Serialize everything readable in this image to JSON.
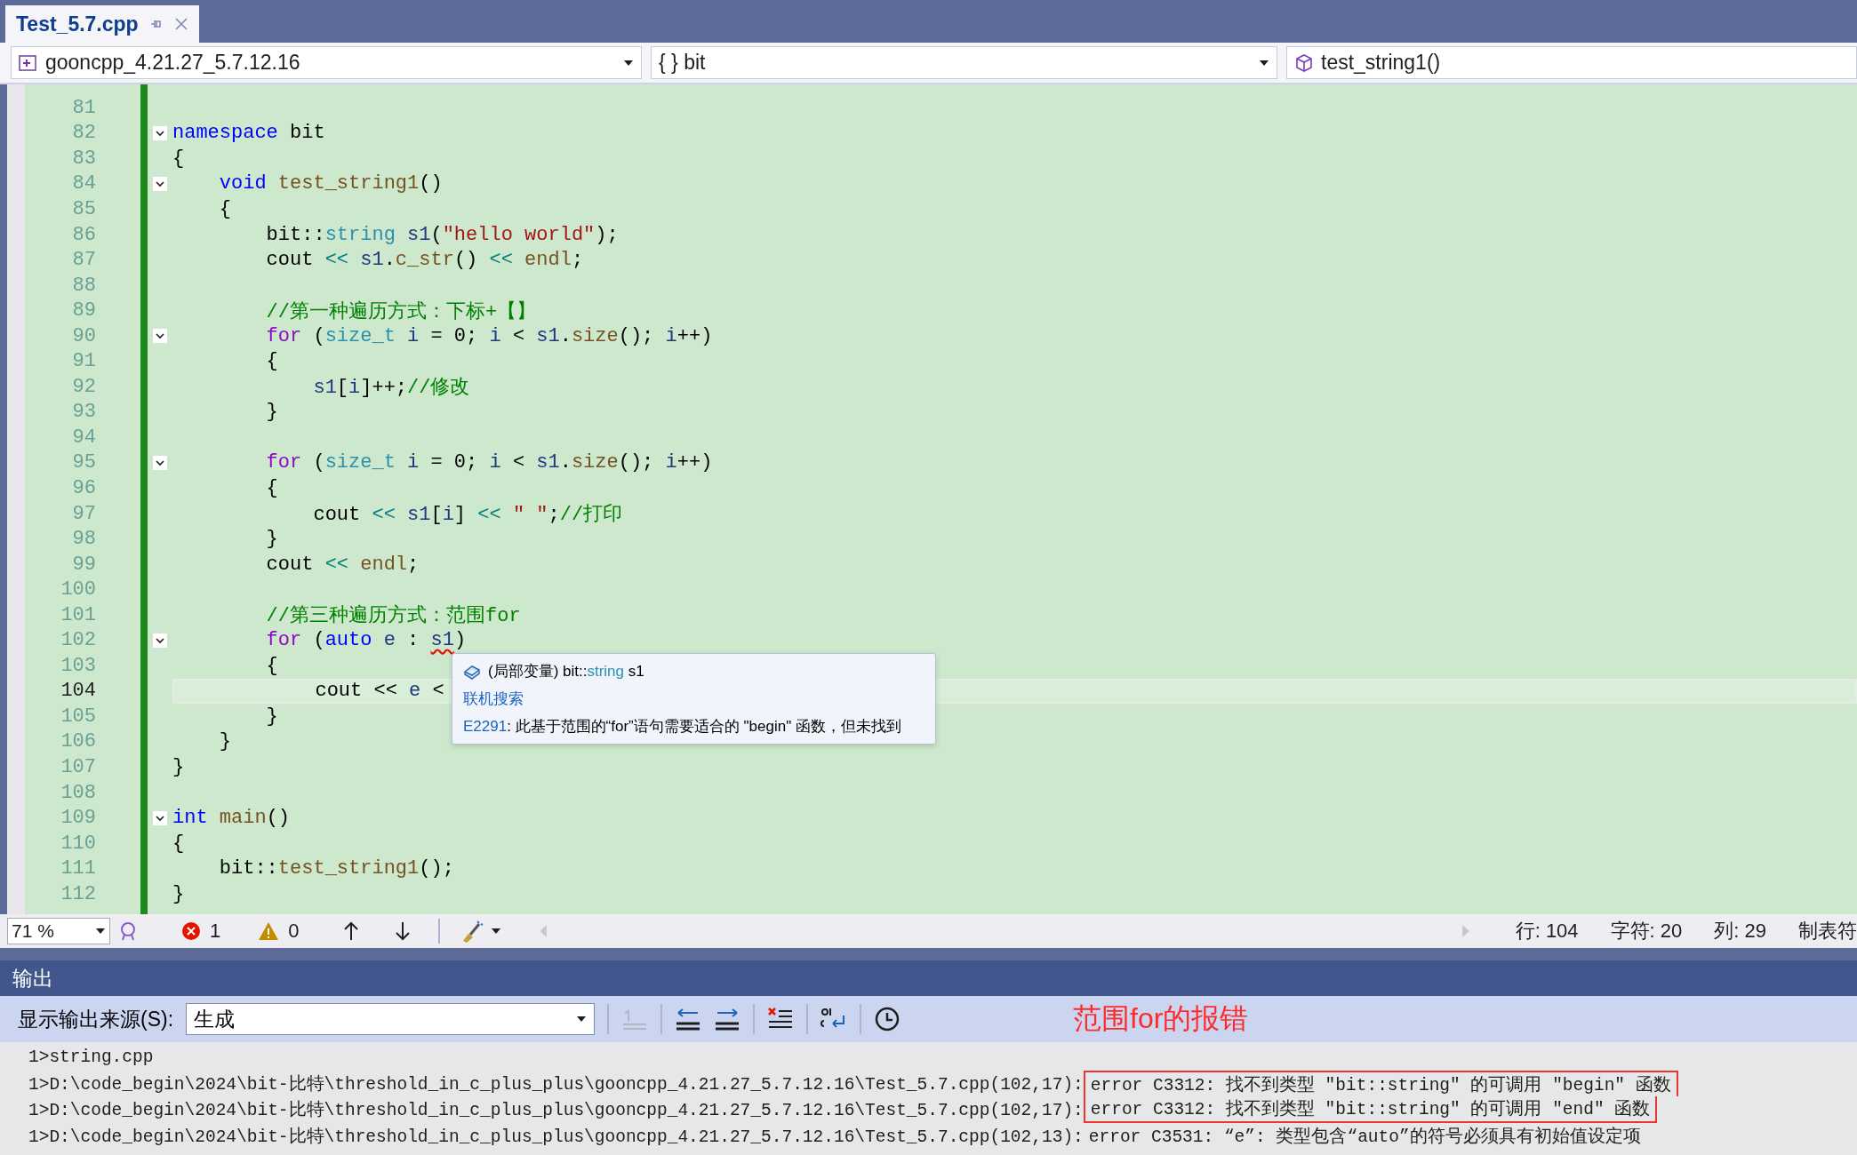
{
  "tabs": [
    {
      "label": "Test_5.7.cpp",
      "selected": true
    }
  ],
  "navigation": {
    "project": "gooncpp_4.21.27_5.7.12.16",
    "scope": "{ } bit",
    "member": "test_string1()"
  },
  "editor": {
    "lines": [
      {
        "number": "81",
        "fold": false,
        "current": false
      },
      {
        "number": "82",
        "fold": true,
        "current": false,
        "tokens": [
          {
            "text": "namespace ",
            "kind": "kw"
          },
          {
            "text": "bit",
            "kind": "plain"
          }
        ]
      },
      {
        "number": "83",
        "fold": false,
        "current": false,
        "tokens": [
          {
            "text": "{",
            "kind": "plain"
          }
        ]
      },
      {
        "number": "84",
        "fold": true,
        "current": false,
        "tokens": [
          {
            "text": "    void ",
            "kind": "kw"
          },
          {
            "text": "test_string1",
            "kind": "fn"
          },
          {
            "text": "()",
            "kind": "plain"
          }
        ]
      },
      {
        "number": "85",
        "fold": false,
        "current": false,
        "tokens": [
          {
            "text": "    {",
            "kind": "plain"
          }
        ]
      },
      {
        "number": "86",
        "fold": false,
        "current": false,
        "tokens": [
          {
            "text": "        bit::",
            "kind": "plain"
          },
          {
            "text": "string ",
            "kind": "type"
          },
          {
            "text": "s1",
            "kind": "var"
          },
          {
            "text": "(",
            "kind": "plain"
          },
          {
            "text": "\"hello world\"",
            "kind": "str"
          },
          {
            "text": ");",
            "kind": "plain"
          }
        ]
      },
      {
        "number": "87",
        "fold": false,
        "current": false,
        "tokens": [
          {
            "text": "        cout ",
            "kind": "plain"
          },
          {
            "text": "<< ",
            "kind": "op"
          },
          {
            "text": "s1",
            "kind": "var"
          },
          {
            "text": ".",
            "kind": "plain"
          },
          {
            "text": "c_str",
            "kind": "fn"
          },
          {
            "text": "() ",
            "kind": "plain"
          },
          {
            "text": "<< ",
            "kind": "op"
          },
          {
            "text": "endl",
            "kind": "fn"
          },
          {
            "text": ";",
            "kind": "plain"
          }
        ]
      },
      {
        "number": "88",
        "fold": false,
        "current": false
      },
      {
        "number": "89",
        "fold": false,
        "current": false,
        "tokens": [
          {
            "text": "        //第一种遍历方式：下标+【】",
            "kind": "cmt"
          }
        ]
      },
      {
        "number": "90",
        "fold": true,
        "current": false,
        "tokens": [
          {
            "text": "        for",
            "kind": "ctl"
          },
          {
            "text": " (",
            "kind": "plain"
          },
          {
            "text": "size_t ",
            "kind": "type"
          },
          {
            "text": "i",
            "kind": "var"
          },
          {
            "text": " = 0; ",
            "kind": "plain"
          },
          {
            "text": "i",
            "kind": "var"
          },
          {
            "text": " < ",
            "kind": "plain"
          },
          {
            "text": "s1",
            "kind": "var"
          },
          {
            "text": ".",
            "kind": "plain"
          },
          {
            "text": "size",
            "kind": "fn"
          },
          {
            "text": "(); ",
            "kind": "plain"
          },
          {
            "text": "i",
            "kind": "var"
          },
          {
            "text": "++)",
            "kind": "plain"
          }
        ]
      },
      {
        "number": "91",
        "fold": false,
        "current": false,
        "tokens": [
          {
            "text": "        {",
            "kind": "plain"
          }
        ]
      },
      {
        "number": "92",
        "fold": false,
        "current": false,
        "tokens": [
          {
            "text": "            s1",
            "kind": "var"
          },
          {
            "text": "[",
            "kind": "plain"
          },
          {
            "text": "i",
            "kind": "var"
          },
          {
            "text": "]++;",
            "kind": "plain"
          },
          {
            "text": "//修改",
            "kind": "cmt"
          }
        ]
      },
      {
        "number": "93",
        "fold": false,
        "current": false,
        "tokens": [
          {
            "text": "        }",
            "kind": "plain"
          }
        ]
      },
      {
        "number": "94",
        "fold": false,
        "current": false
      },
      {
        "number": "95",
        "fold": true,
        "current": false,
        "tokens": [
          {
            "text": "        for",
            "kind": "ctl"
          },
          {
            "text": " (",
            "kind": "plain"
          },
          {
            "text": "size_t ",
            "kind": "type"
          },
          {
            "text": "i",
            "kind": "var"
          },
          {
            "text": " = 0; ",
            "kind": "plain"
          },
          {
            "text": "i",
            "kind": "var"
          },
          {
            "text": " < ",
            "kind": "plain"
          },
          {
            "text": "s1",
            "kind": "var"
          },
          {
            "text": ".",
            "kind": "plain"
          },
          {
            "text": "size",
            "kind": "fn"
          },
          {
            "text": "(); ",
            "kind": "plain"
          },
          {
            "text": "i",
            "kind": "var"
          },
          {
            "text": "++)",
            "kind": "plain"
          }
        ]
      },
      {
        "number": "96",
        "fold": false,
        "current": false,
        "tokens": [
          {
            "text": "        {",
            "kind": "plain"
          }
        ]
      },
      {
        "number": "97",
        "fold": false,
        "current": false,
        "tokens": [
          {
            "text": "            cout ",
            "kind": "plain"
          },
          {
            "text": "<< ",
            "kind": "op"
          },
          {
            "text": "s1",
            "kind": "var"
          },
          {
            "text": "[",
            "kind": "plain"
          },
          {
            "text": "i",
            "kind": "var"
          },
          {
            "text": "] ",
            "kind": "plain"
          },
          {
            "text": "<< ",
            "kind": "op"
          },
          {
            "text": "\" \"",
            "kind": "str"
          },
          {
            "text": ";",
            "kind": "plain"
          },
          {
            "text": "//打印",
            "kind": "cmt"
          }
        ]
      },
      {
        "number": "98",
        "fold": false,
        "current": false,
        "tokens": [
          {
            "text": "        }",
            "kind": "plain"
          }
        ]
      },
      {
        "number": "99",
        "fold": false,
        "current": false,
        "tokens": [
          {
            "text": "        cout ",
            "kind": "plain"
          },
          {
            "text": "<< ",
            "kind": "op"
          },
          {
            "text": "endl",
            "kind": "fn"
          },
          {
            "text": ";",
            "kind": "plain"
          }
        ]
      },
      {
        "number": "100",
        "fold": false,
        "current": false
      },
      {
        "number": "101",
        "fold": false,
        "current": false,
        "tokens": [
          {
            "text": "        //第三种遍历方式：范围for",
            "kind": "cmt"
          }
        ]
      },
      {
        "number": "102",
        "fold": true,
        "current": false,
        "tokens": [
          {
            "text": "        for",
            "kind": "ctl"
          },
          {
            "text": " (",
            "kind": "plain"
          },
          {
            "text": "auto ",
            "kind": "kw"
          },
          {
            "text": "e",
            "kind": "var"
          },
          {
            "text": " : ",
            "kind": "plain"
          },
          {
            "text": "s1",
            "kind": "err"
          },
          {
            "text": ")",
            "kind": "plain"
          }
        ]
      },
      {
        "number": "103",
        "fold": false,
        "current": false,
        "tokens": [
          {
            "text": "        {",
            "kind": "plain"
          }
        ]
      },
      {
        "number": "104",
        "fold": false,
        "current": true,
        "tokens": [
          {
            "text": "            cout << ",
            "kind": "plain"
          },
          {
            "text": "e",
            "kind": "var"
          },
          {
            "text": " <",
            "kind": "plain"
          }
        ]
      },
      {
        "number": "105",
        "fold": false,
        "current": false,
        "tokens": [
          {
            "text": "        }",
            "kind": "plain"
          }
        ]
      },
      {
        "number": "106",
        "fold": false,
        "current": false,
        "tokens": [
          {
            "text": "    }",
            "kind": "plain"
          }
        ]
      },
      {
        "number": "107",
        "fold": false,
        "current": false,
        "tokens": [
          {
            "text": "}",
            "kind": "plain"
          }
        ]
      },
      {
        "number": "108",
        "fold": false,
        "current": false
      },
      {
        "number": "109",
        "fold": true,
        "current": false,
        "tokens": [
          {
            "text": "int ",
            "kind": "kw"
          },
          {
            "text": "main",
            "kind": "fn"
          },
          {
            "text": "()",
            "kind": "plain"
          }
        ]
      },
      {
        "number": "110",
        "fold": false,
        "current": false,
        "tokens": [
          {
            "text": "{",
            "kind": "plain"
          }
        ]
      },
      {
        "number": "111",
        "fold": false,
        "current": false,
        "tokens": [
          {
            "text": "    bit::",
            "kind": "plain"
          },
          {
            "text": "test_string1",
            "kind": "fn"
          },
          {
            "text": "();",
            "kind": "plain"
          }
        ]
      },
      {
        "number": "112",
        "fold": false,
        "current": false,
        "tokens": [
          {
            "text": "}",
            "kind": "plain"
          }
        ]
      }
    ],
    "tooltip": {
      "signature": [
        {
          "text": "(局部变量) bit::",
          "kind": "plain"
        },
        {
          "text": "string",
          "kind": "type"
        },
        {
          "text": " s1",
          "kind": "plain"
        }
      ],
      "link": "联机搜索",
      "error_code": "E2291",
      "error_text": ": 此基于范围的“for”语句需要适合的 \"begin\" 函数，但未找到"
    }
  },
  "status_bar": {
    "zoom": "71 %",
    "errors": "1",
    "warnings": "0",
    "line": "行: 104",
    "char": "字符: 20",
    "column": "列: 29",
    "tabs": "制表符"
  },
  "output": {
    "title": "输出",
    "source_label": "显示输出来源(S):",
    "source": "生成",
    "annotation": "范围for的报错",
    "lines": [
      {
        "text": "1>string.cpp"
      },
      {
        "text": "1>D:\\code_begin\\2024\\bit-比特\\threshold_in_c_plus_plus\\gooncpp_4.21.27_5.7.12.16\\Test_5.7.cpp(102,17):",
        "message": "error C3312: 找不到类型 ″bit::string″ 的可调用 ″begin″ 函数",
        "highlighted": true
      },
      {
        "text": "1>D:\\code_begin\\2024\\bit-比特\\threshold_in_c_plus_plus\\gooncpp_4.21.27_5.7.12.16\\Test_5.7.cpp(102,17):",
        "message": "error C3312: 找不到类型 ″bit::string″ 的可调用 ″end″ 函数",
        "highlighted": true
      },
      {
        "text": "1>D:\\code_begin\\2024\\bit-比特\\threshold_in_c_plus_plus\\gooncpp_4.21.27_5.7.12.16\\Test_5.7.cpp(102,13):",
        "message": "error C3531: “e”: 类型包含“auto”的符号必须具有初始值设定项",
        "highlighted": false
      }
    ]
  }
}
